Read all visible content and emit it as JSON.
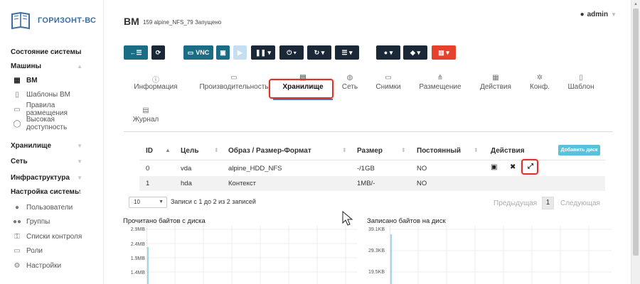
{
  "app": {
    "logo_text": "ГОРИЗОНТ-ВС"
  },
  "sidebar": {
    "items": [
      {
        "label": "Состояние системы",
        "kind": "section"
      },
      {
        "label": "Машины",
        "kind": "section",
        "chevron": "up"
      },
      {
        "label": "ВМ",
        "kind": "sub",
        "icon": "grid-icon",
        "active": true
      },
      {
        "label": "Шаблоны ВМ",
        "kind": "sub",
        "icon": "file-icon"
      },
      {
        "label": "Правила размещения",
        "kind": "sub",
        "icon": "folder-icon"
      },
      {
        "label": "Высокая доступность",
        "kind": "sub",
        "icon": "circle-icon"
      },
      {
        "label": "Хранилище",
        "kind": "section",
        "chevron": "down"
      },
      {
        "label": "Сеть",
        "kind": "section",
        "chevron": "down"
      },
      {
        "label": "Инфраструктура",
        "kind": "section",
        "chevron": "down"
      },
      {
        "label": "Настройка системы",
        "kind": "section",
        "chevron": "up"
      },
      {
        "label": "Пользователи",
        "kind": "sub",
        "icon": "user-icon"
      },
      {
        "label": "Группы",
        "kind": "sub",
        "icon": "users-icon"
      },
      {
        "label": "Списки контроля",
        "kind": "sub",
        "icon": "key-icon"
      },
      {
        "label": "Роли",
        "kind": "sub",
        "icon": "monitor-icon"
      },
      {
        "label": "Настройки",
        "kind": "sub",
        "icon": "gear-icon"
      }
    ]
  },
  "header": {
    "title": "ВМ",
    "subtitle": "159 alpine_NFS_79 Запущено",
    "user": "admin"
  },
  "toolbar": {
    "vnc_label": "VNC"
  },
  "tabs": [
    {
      "label": "Информация",
      "icon": "info-icon"
    },
    {
      "label": "Производительность",
      "icon": "laptop-icon"
    },
    {
      "label": "Хранилище",
      "icon": "storage-icon",
      "active": true
    },
    {
      "label": "Сеть",
      "icon": "globe-icon"
    },
    {
      "label": "Снимки",
      "icon": "laptop-icon"
    },
    {
      "label": "Размещение",
      "icon": "sitemap-icon"
    },
    {
      "label": "Действия",
      "icon": "calendar-icon"
    },
    {
      "label": "Конф.",
      "icon": "cog-icon"
    },
    {
      "label": "Шаблон",
      "icon": "file-icon"
    },
    {
      "label": "Журнал",
      "icon": "file-text-icon"
    }
  ],
  "disks": {
    "columns": [
      "ID",
      "Цель",
      "Образ / Размер-Формат",
      "Размер",
      "Постоянный",
      "Действия"
    ],
    "add_button": "Добавить диск",
    "rows": [
      {
        "id": "0",
        "target": "vda",
        "image": "alpine_HDD_NFS",
        "size": "-/1GB",
        "persistent": "NO"
      },
      {
        "id": "1",
        "target": "hda",
        "image": "Контекст",
        "size": "1MB/-",
        "persistent": "NO"
      }
    ]
  },
  "pagination": {
    "length": "10",
    "info": "Записи с 1 до 2 из 2 записей",
    "prev": "Предыдущая",
    "current": "1",
    "next": "Следующая"
  },
  "charts": {
    "read_title": "Прочитано байтов с диска",
    "read_ticks": [
      "2.9MB",
      "2.4MB",
      "1.9MB",
      "1.4MB"
    ],
    "write_title": "Записано байтов на диск",
    "write_ticks": [
      "39.1KB",
      "29.3KB",
      "19.5KB"
    ]
  },
  "colors": {
    "accent": "#1b6d85",
    "dark": "#1a2838",
    "danger": "#e5412d",
    "info": "#5bc0de",
    "highlight": "#d9342b"
  }
}
